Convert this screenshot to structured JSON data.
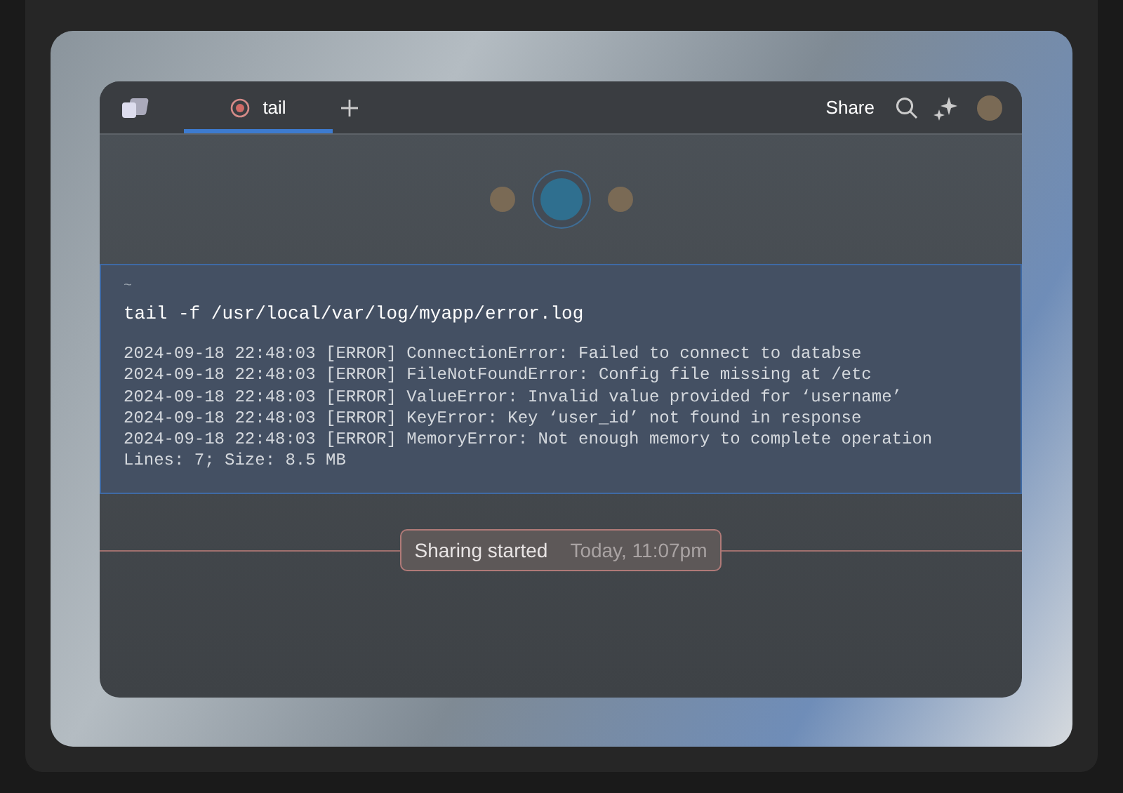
{
  "tabs": [
    {
      "label": "tail",
      "selected": true
    }
  ],
  "header": {
    "share": "Share"
  },
  "participants": [
    {
      "selected": false
    },
    {
      "selected": true
    },
    {
      "selected": false
    }
  ],
  "terminal": {
    "prompt": "~",
    "command": "tail -f /usr/local/var/log/myapp/error.log",
    "output": [
      "2024-09-18 22:48:03 [ERROR] ConnectionError: Failed to connect to databse",
      "2024-09-18 22:48:03 [ERROR] FileNotFoundError: Config file missing at /etc",
      "2024-09-18 22:48:03 [ERROR] ValueError: Invalid value provided for ‘username’",
      "2024-09-18 22:48:03 [ERROR] KeyError: Key ‘user_id’ not found in response",
      "2024-09-18 22:48:03 [ERROR] MemoryError: Not enough memory to complete operation",
      "Lines: 7; Size: 8.5 MB"
    ]
  },
  "event": {
    "label": "Sharing started",
    "time": "Today, 11:07pm"
  }
}
